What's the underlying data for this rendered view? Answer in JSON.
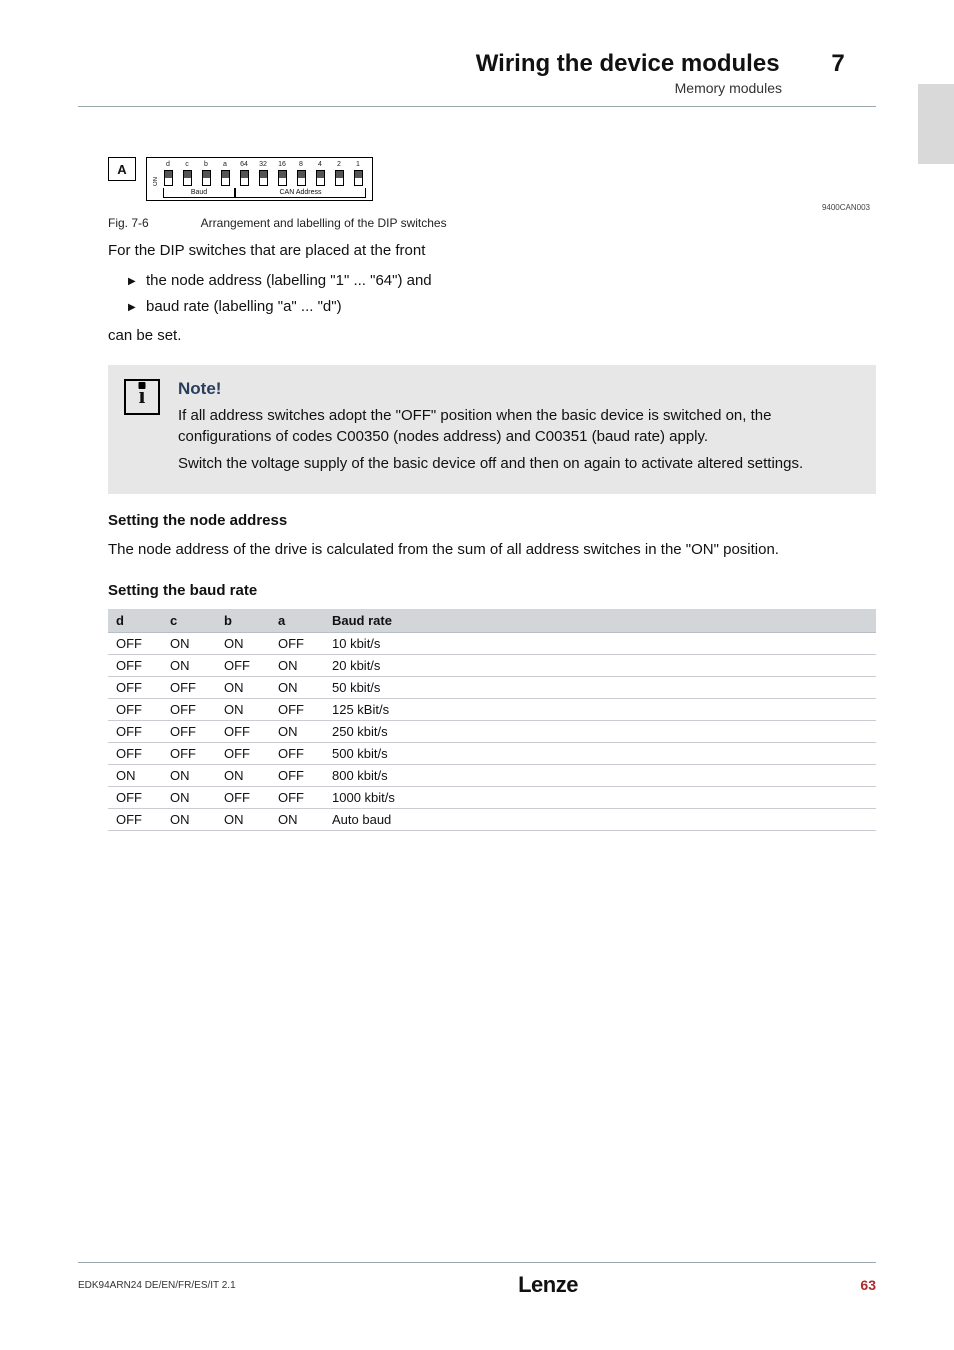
{
  "header": {
    "title": "Wiring the device modules",
    "subtitle": "Memory modules",
    "chapter_num": "7"
  },
  "dip": {
    "box_label": "A",
    "labels": [
      "d",
      "c",
      "b",
      "a",
      "64",
      "32",
      "16",
      "8",
      "4",
      "2",
      "1"
    ],
    "group_baud": "Baud",
    "group_addr": "CAN Address",
    "on": "ON",
    "img_code": "9400CAN003"
  },
  "fig": {
    "num": "Fig. 7-6",
    "cap": "Arrangement and labelling of the DIP switches"
  },
  "intro": "For the DIP switches that are placed at the front",
  "bullets": [
    "the node address (labelling \"1\" ... \"64\") and",
    "baud rate (labelling \"a\" ... \"d\")"
  ],
  "after_bullets": "can be set.",
  "note": {
    "title": "Note!",
    "p1": "If all address switches adopt the \"OFF\" position when the basic device is switched on, the configurations of codes C00350 (nodes address) and C00351 (baud rate) apply.",
    "p2": "Switch the voltage supply of the basic device off and then on again to activate altered settings."
  },
  "sect_addr": {
    "h": "Setting the node address",
    "p": "The node address of the drive is calculated from the sum of all address switches in the \"ON\" position."
  },
  "sect_baud": {
    "h": "Setting the baud rate",
    "cols": {
      "d": "d",
      "c": "c",
      "b": "b",
      "a": "a",
      "rate": "Baud rate"
    },
    "rows": [
      {
        "d": "OFF",
        "c": "ON",
        "b": "ON",
        "a": "OFF",
        "rate": "10 kbit/s"
      },
      {
        "d": "OFF",
        "c": "ON",
        "b": "OFF",
        "a": "ON",
        "rate": "20 kbit/s"
      },
      {
        "d": "OFF",
        "c": "OFF",
        "b": "ON",
        "a": "ON",
        "rate": "50 kbit/s"
      },
      {
        "d": "OFF",
        "c": "OFF",
        "b": "ON",
        "a": "OFF",
        "rate": "125 kBit/s"
      },
      {
        "d": "OFF",
        "c": "OFF",
        "b": "OFF",
        "a": "ON",
        "rate": "250 kbit/s"
      },
      {
        "d": "OFF",
        "c": "OFF",
        "b": "OFF",
        "a": "OFF",
        "rate": "500 kbit/s"
      },
      {
        "d": "ON",
        "c": "ON",
        "b": "ON",
        "a": "OFF",
        "rate": "800 kbit/s"
      },
      {
        "d": "OFF",
        "c": "ON",
        "b": "OFF",
        "a": "OFF",
        "rate": "1000 kbit/s"
      },
      {
        "d": "OFF",
        "c": "ON",
        "b": "ON",
        "a": "ON",
        "rate": "Auto baud"
      }
    ]
  },
  "footer": {
    "left": "EDK94ARN24  DE/EN/FR/ES/IT  2.1",
    "logo": "Lenze",
    "page": "63"
  }
}
